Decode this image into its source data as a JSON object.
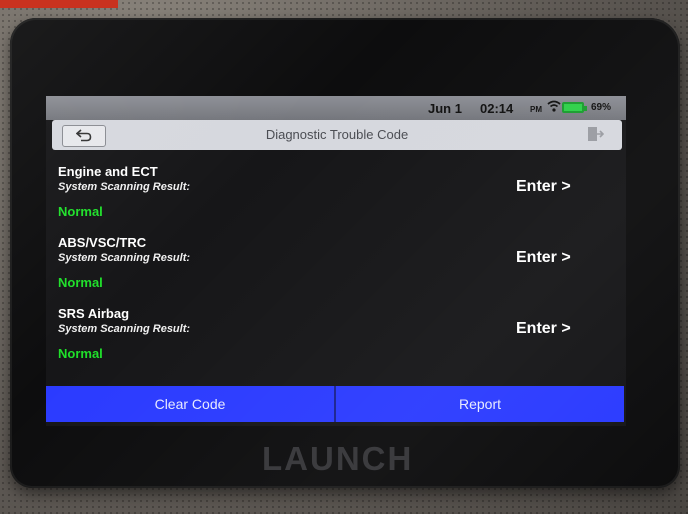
{
  "status_bar": {
    "date": "Jun 1",
    "time": "02:14",
    "ampm": "PM",
    "battery_percent": "69%",
    "battery_level": 0.69,
    "icons": [
      "wifi-icon",
      "battery-icon"
    ]
  },
  "header": {
    "title": "Diagnostic Trouble Code",
    "back_icon": "back-arrow-icon",
    "exit_icon": "exit-icon"
  },
  "systems": [
    {
      "name": "Engine and ECT",
      "subtitle": "System Scanning Result:",
      "result": "Normal",
      "action": "Enter >"
    },
    {
      "name": "ABS/VSC/TRC",
      "subtitle": "System Scanning Result:",
      "result": "Normal",
      "action": "Enter >"
    },
    {
      "name": "SRS Airbag",
      "subtitle": "System Scanning Result:",
      "result": "Normal",
      "action": "Enter >"
    }
  ],
  "footer": {
    "clear_code_label": "Clear Code",
    "report_label": "Report"
  },
  "device": {
    "brand": "LAUNCH"
  },
  "colors": {
    "result_ok": "#1fe02a",
    "button_bar": "#2b3bff",
    "battery": "#2fd14a"
  }
}
